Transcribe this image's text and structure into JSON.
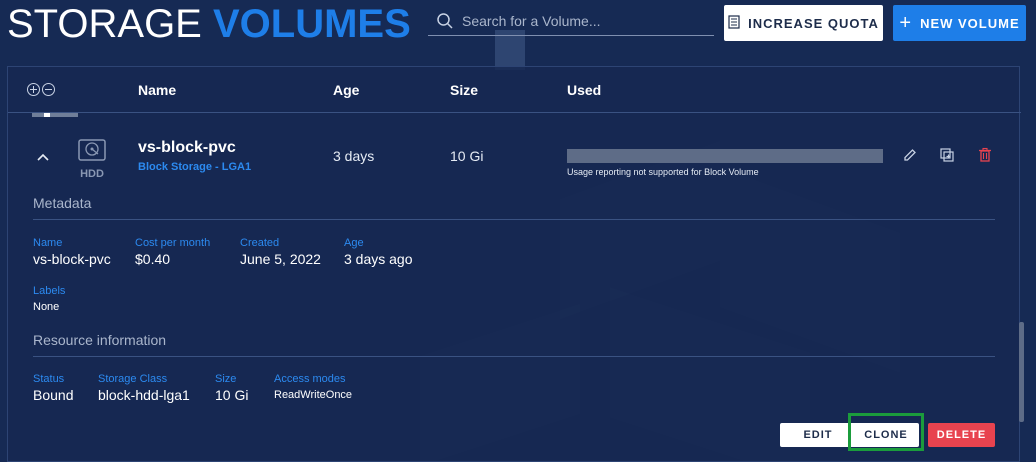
{
  "header": {
    "title_part1": "STORAGE",
    "title_part2": "VOLUMES",
    "search_placeholder": "Search for a Volume...",
    "increase_quota_label": "INCREASE QUOTA",
    "new_volume_label": "NEW VOLUME"
  },
  "table": {
    "columns": [
      "Name",
      "Age",
      "Size",
      "Used"
    ]
  },
  "volume": {
    "type_label": "HDD",
    "name": "vs-block-pvc",
    "storage_class_link": "Block Storage - LGA1",
    "age": "3 days",
    "size": "10 Gi",
    "usage_note": "Usage reporting not supported for Block Volume"
  },
  "metadata": {
    "title": "Metadata",
    "fields": [
      {
        "label": "Name",
        "value": "vs-block-pvc"
      },
      {
        "label": "Cost per month",
        "value": "$0.40"
      },
      {
        "label": "Created",
        "value": "June 5, 2022"
      },
      {
        "label": "Age",
        "value": "3 days ago"
      }
    ],
    "labels": {
      "label": "Labels",
      "value": "None"
    }
  },
  "resource": {
    "title": "Resource information",
    "fields": [
      {
        "label": "Status",
        "value": "Bound"
      },
      {
        "label": "Storage Class",
        "value": "block-hdd-lga1"
      },
      {
        "label": "Size",
        "value": "10 Gi"
      },
      {
        "label": "Access modes",
        "value": "ReadWriteOnce"
      }
    ]
  },
  "actions": {
    "edit_label": "EDIT",
    "clone_label": "CLONE",
    "delete_label": "DELETE"
  },
  "colors": {
    "accent": "#1e7ee8",
    "danger": "#e8434f",
    "highlight": "#1b9c3c"
  }
}
